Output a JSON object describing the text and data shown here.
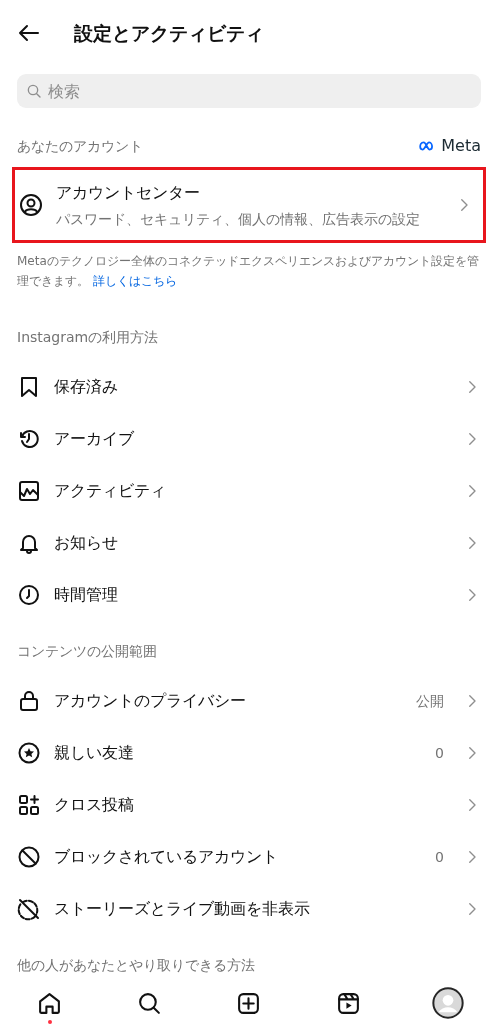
{
  "header": {
    "title": "設定とアクティビティ"
  },
  "search": {
    "placeholder": "検索"
  },
  "account_section": {
    "label": "あなたのアカウント",
    "brand": "Meta",
    "account_center": {
      "title": "アカウントセンター",
      "subtitle": "パスワード、セキュリティ、個人の情報、広告表示の設定",
      "highlighted": true
    },
    "description": "Metaのテクノロジー全体のコネクテッドエクスペリエンスおよびアカウント設定を管理できます。",
    "link": "詳しくはこちら"
  },
  "sections": [
    {
      "label": "Instagramの利用方法",
      "items": [
        {
          "kind": "saved",
          "label": "保存済み"
        },
        {
          "kind": "archive",
          "label": "アーカイブ"
        },
        {
          "kind": "activity",
          "label": "アクティビティ"
        },
        {
          "kind": "notifications",
          "label": "お知らせ"
        },
        {
          "kind": "time",
          "label": "時間管理"
        }
      ]
    },
    {
      "label": "コンテンツの公開範囲",
      "items": [
        {
          "kind": "privacy",
          "label": "アカウントのプライバシー",
          "value": "公開"
        },
        {
          "kind": "close_friends",
          "label": "親しい友達",
          "value": "0"
        },
        {
          "kind": "crosspost",
          "label": "クロス投稿"
        },
        {
          "kind": "blocked",
          "label": "ブロックされているアカウント",
          "value": "0"
        },
        {
          "kind": "hide",
          "label": "ストーリーズとライブ動画を非表示"
        }
      ]
    },
    {
      "label": "他の人があなたとやり取りできる方法"
    }
  ],
  "nav": [
    {
      "kind": "home",
      "notification": true
    },
    {
      "kind": "search",
      "notification": false
    },
    {
      "kind": "create",
      "notification": false
    },
    {
      "kind": "reels",
      "notification": false
    },
    {
      "kind": "profile",
      "notification": false
    }
  ]
}
